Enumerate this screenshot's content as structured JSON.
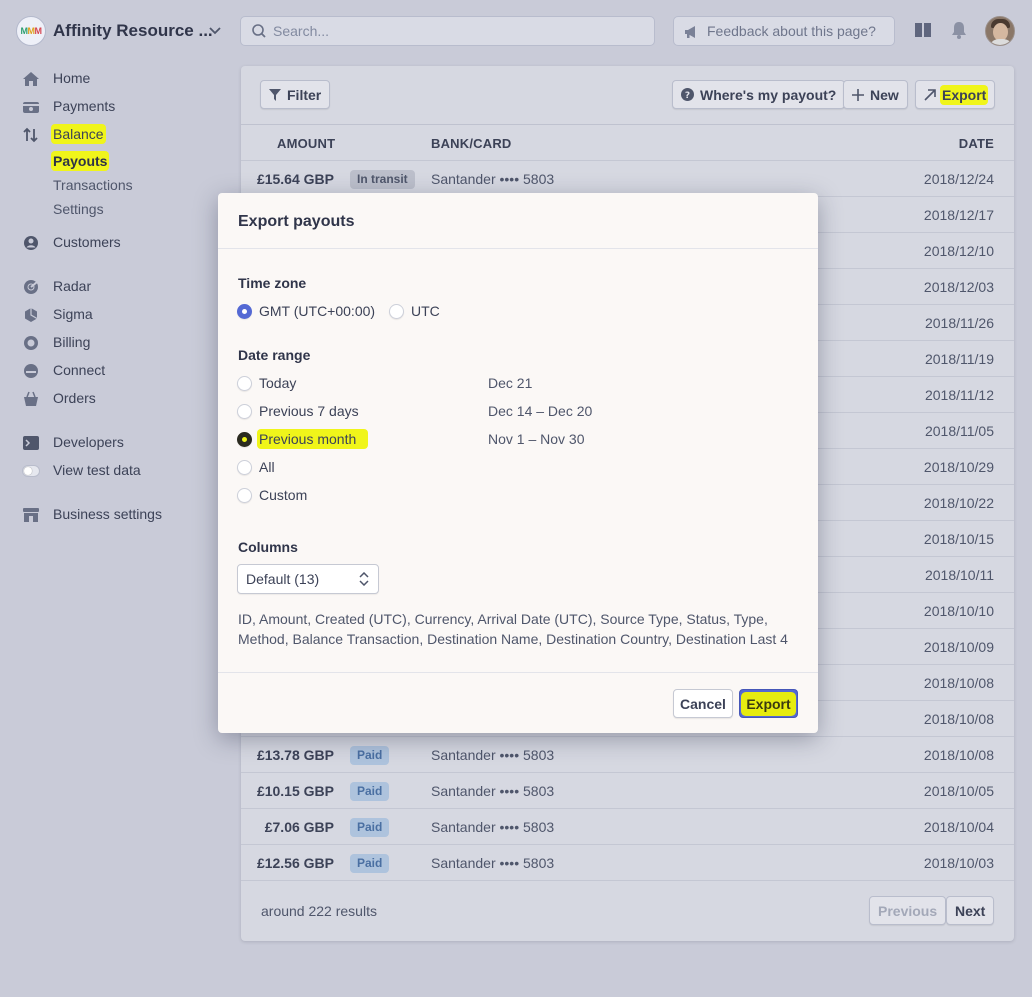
{
  "topbar": {
    "account_name": "Affinity Resource ...",
    "search_placeholder": "Search...",
    "feedback_label": "Feedback about this page?"
  },
  "sidebar": {
    "home": "Home",
    "payments": "Payments",
    "balance": "Balance",
    "balance_sub": [
      "Payouts",
      "Transactions",
      "Settings"
    ],
    "customers": "Customers",
    "radar": "Radar",
    "sigma": "Sigma",
    "billing": "Billing",
    "connect": "Connect",
    "orders": "Orders",
    "developers": "Developers",
    "view_test_data": "View test data",
    "business_settings": "Business settings"
  },
  "toolbar": {
    "filter": "Filter",
    "where_payout": "Where's my payout?",
    "new": "New",
    "export": "Export"
  },
  "table": {
    "headers": {
      "amount": "AMOUNT",
      "bank": "BANK/CARD",
      "date": "DATE"
    },
    "rows": [
      {
        "amount": "£15.64 GBP",
        "status": "In transit",
        "bank": "Santander •••• 5803",
        "date": "2018/12/24"
      },
      {
        "amount": "",
        "status": "",
        "bank": "",
        "date": "2018/12/17"
      },
      {
        "amount": "",
        "status": "",
        "bank": "",
        "date": "2018/12/10"
      },
      {
        "amount": "",
        "status": "",
        "bank": "",
        "date": "2018/12/03"
      },
      {
        "amount": "",
        "status": "",
        "bank": "",
        "date": "2018/11/26"
      },
      {
        "amount": "",
        "status": "",
        "bank": "",
        "date": "2018/11/19"
      },
      {
        "amount": "",
        "status": "",
        "bank": "",
        "date": "2018/11/12"
      },
      {
        "amount": "",
        "status": "",
        "bank": "",
        "date": "2018/11/05"
      },
      {
        "amount": "",
        "status": "",
        "bank": "",
        "date": "2018/10/29"
      },
      {
        "amount": "",
        "status": "",
        "bank": "",
        "date": "2018/10/22"
      },
      {
        "amount": "",
        "status": "",
        "bank": "",
        "date": "2018/10/15"
      },
      {
        "amount": "",
        "status": "",
        "bank": "",
        "date": "2018/10/11"
      },
      {
        "amount": "",
        "status": "",
        "bank": "",
        "date": "2018/10/10"
      },
      {
        "amount": "",
        "status": "",
        "bank": "",
        "date": "2018/10/09"
      },
      {
        "amount": "",
        "status": "",
        "bank": "",
        "date": "2018/10/08"
      },
      {
        "amount": "",
        "status": "",
        "bank": "",
        "date": "2018/10/08"
      },
      {
        "amount": "£13.78 GBP",
        "status": "Paid",
        "bank": "Santander •••• 5803",
        "date": "2018/10/08"
      },
      {
        "amount": "£10.15 GBP",
        "status": "Paid",
        "bank": "Santander •••• 5803",
        "date": "2018/10/05"
      },
      {
        "amount": "£7.06 GBP",
        "status": "Paid",
        "bank": "Santander •••• 5803",
        "date": "2018/10/04"
      },
      {
        "amount": "£12.56 GBP",
        "status": "Paid",
        "bank": "Santander •••• 5803",
        "date": "2018/10/03"
      }
    ],
    "results": "around 222 results",
    "previous": "Previous",
    "next": "Next"
  },
  "modal": {
    "title": "Export payouts",
    "timezone_title": "Time zone",
    "timezone_options": [
      "GMT (UTC+00:00)",
      "UTC"
    ],
    "timezone_selected": "GMT (UTC+00:00)",
    "daterange_title": "Date range",
    "daterange_options": [
      {
        "label": "Today",
        "hint": "Dec 21"
      },
      {
        "label": "Previous 7 days",
        "hint": "Dec 14 – Dec 20"
      },
      {
        "label": "Previous month",
        "hint": "Nov 1 – Nov 30"
      },
      {
        "label": "All",
        "hint": ""
      },
      {
        "label": "Custom",
        "hint": ""
      }
    ],
    "daterange_selected": "Previous month",
    "columns_title": "Columns",
    "columns_select": "Default (13)",
    "columns_description": "ID, Amount, Created (UTC), Currency, Arrival Date (UTC), Source Type, Status, Type, Method, Balance Transaction, Destination Name, Destination Country, Destination Last 4",
    "cancel": "Cancel",
    "export": "Export"
  },
  "colors": {
    "accent": "#5469d4",
    "highlight": "#f0f51a",
    "paid_badge": "#aec3dd",
    "transit_badge": "#bcbfcb"
  },
  "icons": [
    "search-icon",
    "megaphone-icon",
    "docs-icon",
    "bell-icon",
    "home-icon",
    "payments-icon",
    "balance-icon",
    "customers-icon",
    "radar-icon",
    "sigma-icon",
    "billing-icon",
    "connect-icon",
    "orders-icon",
    "developers-icon",
    "business-icon",
    "filter-icon",
    "help-icon",
    "plus-icon",
    "export-arrow-icon",
    "select-arrows-icon",
    "chevron-down-icon"
  ]
}
